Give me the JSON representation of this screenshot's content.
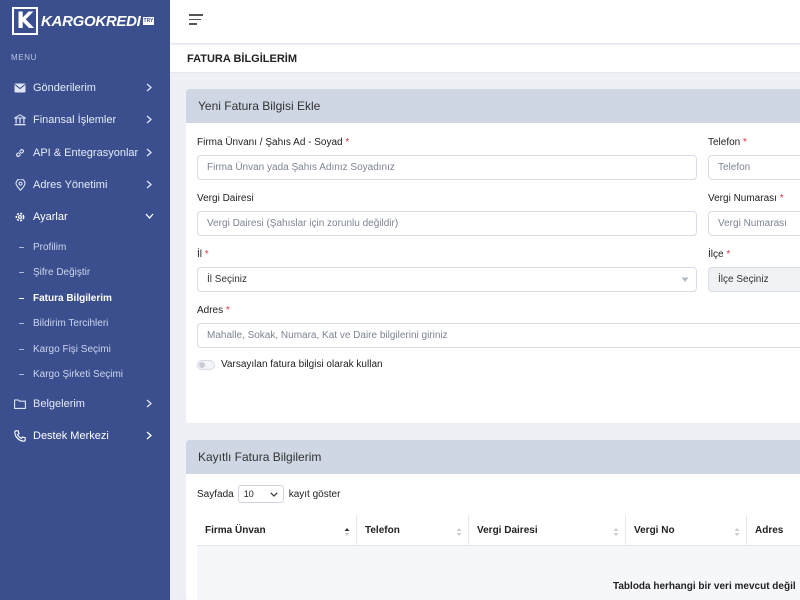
{
  "brand": {
    "logo_letter": "K",
    "name": "KARGOKREDI",
    "tag": "TRY"
  },
  "sidebar": {
    "menu_label": "MENU",
    "items": [
      {
        "label": "Gönderilerim",
        "icon": "mail-icon"
      },
      {
        "label": "Finansal İşlemler",
        "icon": "bank-icon"
      },
      {
        "label": "API & Entegrasyonlar",
        "icon": "link-icon"
      },
      {
        "label": "Adres Yönetimi",
        "icon": "location-icon"
      },
      {
        "label": "Ayarlar",
        "icon": "gear-icon"
      },
      {
        "label": "Belgelerim",
        "icon": "folder-icon"
      },
      {
        "label": "Destek Merkezi",
        "icon": "phone-icon"
      }
    ],
    "sub_items": [
      {
        "label": "Profilim"
      },
      {
        "label": "Şifre Değiştir"
      },
      {
        "label": "Fatura Bilgilerim"
      },
      {
        "label": "Bildirim Tercihleri"
      },
      {
        "label": "Kargo Fişi Seçimi"
      },
      {
        "label": "Kargo Şirketi Seçimi"
      }
    ]
  },
  "page": {
    "title": "FATURA BİLGİLERİM"
  },
  "form": {
    "card_title": "Yeni Fatura Bilgisi Ekle",
    "firma": {
      "label": "Firma Ünvanı / Şahıs Ad - Soyad",
      "placeholder": "Firma Ünvan yada Şahıs Adınız Soyadınız"
    },
    "telefon": {
      "label": "Telefon",
      "placeholder": "Telefon"
    },
    "vergi_dairesi": {
      "label": "Vergi Dairesi",
      "placeholder": "Vergi Dairesi (Şahıslar için zorunlu değildir)"
    },
    "vergi_no": {
      "label": "Vergi Numarası",
      "placeholder": "Vergi Numarası"
    },
    "il": {
      "label": "İl",
      "value": "İl Seçiniz"
    },
    "ilce": {
      "label": "İlçe",
      "value": "İlçe Seçiniz"
    },
    "adres": {
      "label": "Adres",
      "placeholder": "Mahalle, Sokak, Numara, Kat ve Daire bilgilerini giriniz"
    },
    "required_mark": "*",
    "default_toggle": {
      "label": "Varsayılan fatura bilgisi olarak kullan",
      "checked": false
    }
  },
  "saved": {
    "card_title": "Kayıtlı Fatura Bilgilerim",
    "length_prefix": "Sayfada",
    "length_value": "10",
    "length_suffix": "kayıt göster",
    "columns": [
      "Firma Ünvan",
      "Telefon",
      "Vergi Dairesi",
      "Vergi No",
      "Adres"
    ],
    "empty_message": "Tabloda herhangi bir veri mevcut değil"
  }
}
